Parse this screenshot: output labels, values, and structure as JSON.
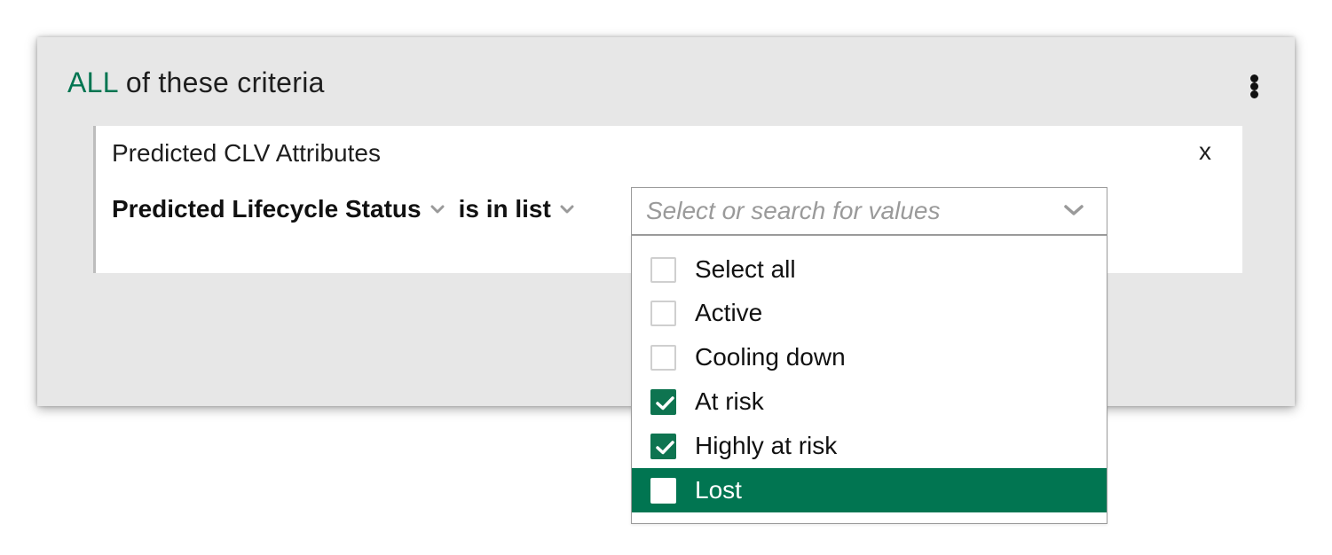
{
  "group": {
    "quantifier": "ALL",
    "title_rest": " of these criteria",
    "menu_icon": "more-vertical-icon"
  },
  "criterion": {
    "title": "Predicted CLV Attributes",
    "close_label": "x",
    "attribute": "Predicted Lifecycle Status",
    "operator": "is in list",
    "chevron_icon": "chevron-down-icon"
  },
  "value_select": {
    "placeholder": "Select or search for values",
    "chevron_icon": "chevron-down-icon",
    "options": [
      {
        "label": "Select all",
        "checked": false,
        "highlighted": false
      },
      {
        "label": "Active",
        "checked": false,
        "highlighted": false
      },
      {
        "label": "Cooling down",
        "checked": false,
        "highlighted": false
      },
      {
        "label": "At risk",
        "checked": true,
        "highlighted": false
      },
      {
        "label": "Highly at risk",
        "checked": true,
        "highlighted": false
      },
      {
        "label": "Lost",
        "checked": false,
        "highlighted": true
      }
    ]
  },
  "colors": {
    "accent_green": "#017551",
    "panel_bg": "#e7e7e7"
  }
}
